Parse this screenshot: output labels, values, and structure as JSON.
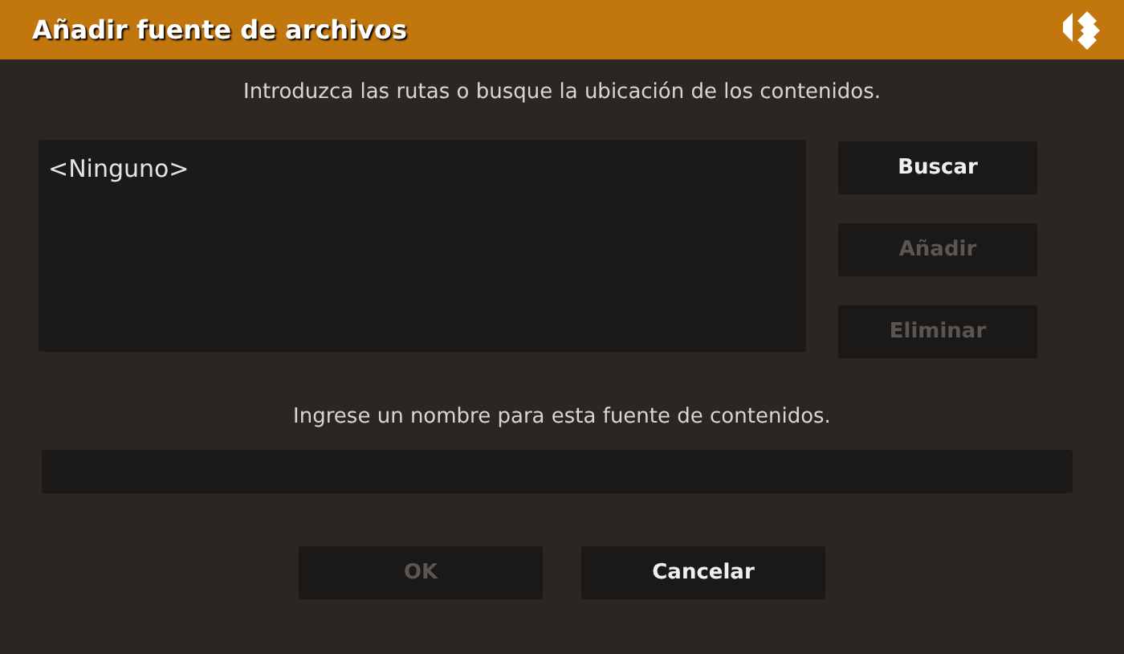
{
  "window": {
    "title": "Añadir fuente de archivos"
  },
  "paths_prompt": "Introduzca las rutas o busque la ubicación de los contenidos.",
  "paths": [
    "<Ninguno>"
  ],
  "side_buttons": [
    {
      "label": "Buscar",
      "disabled": false
    },
    {
      "label": "Añadir",
      "disabled": true
    },
    {
      "label": "Eliminar",
      "disabled": true
    }
  ],
  "name_prompt": "Ingrese un nombre para esta fuente de contenidos.",
  "footer_buttons": [
    {
      "label": "OK",
      "disabled": true
    },
    {
      "label": "Cancelar",
      "disabled": false
    }
  ]
}
